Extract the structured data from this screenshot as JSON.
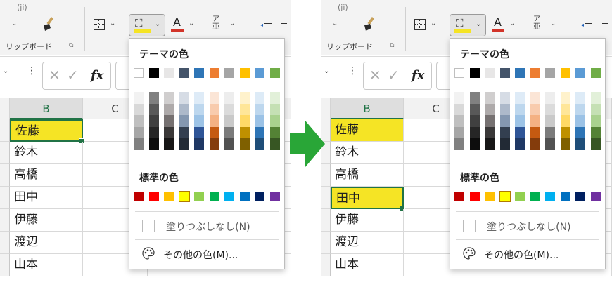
{
  "arrow_color": "#29a637",
  "panels": [
    {
      "id": "left",
      "ribbon": {
        "clipboard_label": "リップボード",
        "top_cut": "(ji)"
      },
      "columns": [
        "B",
        "C"
      ],
      "cells": [
        "佐藤",
        "鈴木",
        "高橋",
        "田中",
        "伊藤",
        "渡辺",
        "山本"
      ],
      "highlighted_rows": [
        0
      ],
      "active_row": 0,
      "menu": {
        "theme_heading": "テーマの色",
        "standard_heading": "標準の色",
        "no_fill": "塗りつぶしなし(N)",
        "more_colors": "その他の色(M)..."
      }
    },
    {
      "id": "right",
      "ribbon": {
        "clipboard_label": "リップボード",
        "top_cut": "(ji)"
      },
      "columns": [
        "B",
        "C"
      ],
      "cells": [
        "佐藤",
        "鈴木",
        "高橋",
        "田中",
        "伊藤",
        "渡辺",
        "山本"
      ],
      "highlighted_rows": [
        0,
        3
      ],
      "active_row": 3,
      "menu": {
        "theme_heading": "テーマの色",
        "standard_heading": "標準の色",
        "no_fill": "塗りつぶしなし(N)",
        "more_colors": "その他の色(M)..."
      }
    }
  ],
  "theme_colors": [
    "#ffffff",
    "#000000",
    "#e7e6e6",
    "#44546a",
    "#2e75b6",
    "#ed7d31",
    "#a5a5a5",
    "#ffc000",
    "#5b9bd5",
    "#70ad47"
  ],
  "theme_shades": [
    [
      "#f2f2f2",
      "#d9d9d9",
      "#bfbfbf",
      "#a6a6a6",
      "#808080"
    ],
    [
      "#808080",
      "#595959",
      "#404040",
      "#262626",
      "#0d0d0d"
    ],
    [
      "#d0cece",
      "#aeaaaa",
      "#767171",
      "#3a3838",
      "#171616"
    ],
    [
      "#d6dce5",
      "#adb9ca",
      "#8497b0",
      "#333f50",
      "#222a35"
    ],
    [
      "#deebf7",
      "#bdd7ee",
      "#9dc3e6",
      "#2f5597",
      "#1f3864"
    ],
    [
      "#fbe5d6",
      "#f8cbad",
      "#f4b183",
      "#c55a11",
      "#843c0c"
    ],
    [
      "#ededed",
      "#dbdbdb",
      "#c9c9c9",
      "#7b7b7b",
      "#525252"
    ],
    [
      "#fff2cc",
      "#ffe699",
      "#ffd966",
      "#bf9000",
      "#7f6000"
    ],
    [
      "#ddebf7",
      "#bdd7ee",
      "#9bc2e6",
      "#2e75b6",
      "#1f4e79"
    ],
    [
      "#e2f0d9",
      "#c5e0b4",
      "#a9d18e",
      "#548235",
      "#375623"
    ]
  ],
  "standard_colors": [
    "#c00000",
    "#ff0000",
    "#ffc000",
    "#ffff00",
    "#92d050",
    "#00b050",
    "#00b0f0",
    "#0070c0",
    "#002060",
    "#7030a0"
  ],
  "standard_selected_index": 3,
  "fill_current": "#f5e425",
  "font_color_current": "#d2342a"
}
